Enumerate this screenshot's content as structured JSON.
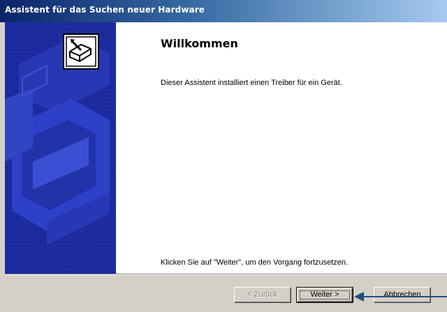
{
  "window": {
    "title": "Assistent für das Suchen neuer Hardware"
  },
  "banner": {
    "icon": "hardware-wizard-icon",
    "background_color": "#1b2a9c"
  },
  "content": {
    "heading": "Willkommen",
    "intro": "Dieser Assistent installiert einen Treiber für ein Gerät.",
    "hint": "Klicken Sie auf \"Weiter\", um den Vorgang fortzusetzen."
  },
  "buttons": {
    "back": {
      "label": "< Zurück",
      "enabled": false
    },
    "next": {
      "label": "Weiter >",
      "default": true
    },
    "cancel": {
      "label": "Abbrechen"
    }
  },
  "annotation": {
    "icon": "arrow-pointer-icon",
    "color": "#1f4f7a"
  }
}
